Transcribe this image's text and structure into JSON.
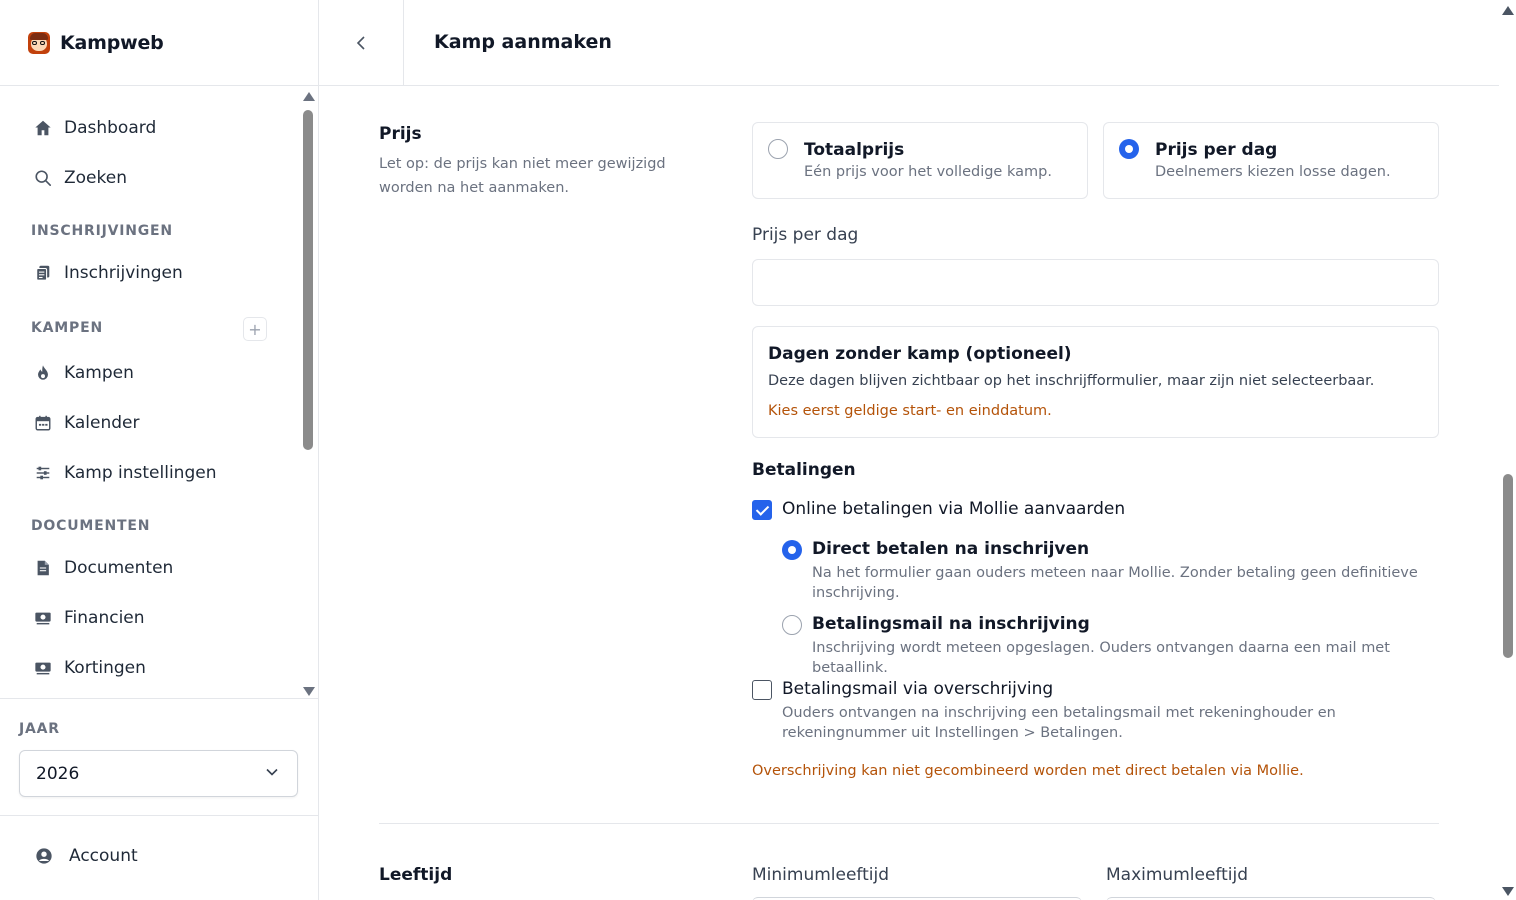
{
  "app": {
    "name": "Kampweb"
  },
  "header": {
    "title": "Kamp aanmaken",
    "back_icon": "chevron-left-icon"
  },
  "sidebar": {
    "items": [
      {
        "label": "Dashboard",
        "icon": "home-icon"
      },
      {
        "label": "Zoeken",
        "icon": "search-icon"
      }
    ],
    "sections": [
      {
        "title": "INSCHRIJVINGEN",
        "items": [
          {
            "label": "Inschrijvingen",
            "icon": "clipboard-icon"
          }
        ]
      },
      {
        "title": "KAMPEN",
        "items": [
          {
            "label": "Kampen",
            "icon": "fire-icon"
          },
          {
            "label": "Kalender",
            "icon": "calendar-icon"
          },
          {
            "label": "Kamp instellingen",
            "icon": "sliders-icon"
          }
        ]
      },
      {
        "title": "DOCUMENTEN",
        "items": [
          {
            "label": "Documenten",
            "icon": "document-icon"
          },
          {
            "label": "Financien",
            "icon": "money-icon"
          },
          {
            "label": "Kortingen",
            "icon": "money-icon"
          }
        ]
      }
    ],
    "add_label": "+",
    "year": {
      "label": "JAAR",
      "value": "2026"
    },
    "account": {
      "label": "Account",
      "icon": "user-circle-icon"
    }
  },
  "form": {
    "price": {
      "title": "Prijs",
      "description": "Let op: de prijs kan niet meer gewijzigd worden na het aanmaken.",
      "options": [
        {
          "title": "Totaalprijs",
          "description": "Eén prijs voor het volledige kamp.",
          "selected": false
        },
        {
          "title": "Prijs per dag",
          "description": "Deelnemers kiezen losse dagen.",
          "selected": true
        }
      ],
      "per_day_label": "Prijs per dag",
      "per_day_value": "",
      "days_off": {
        "title": "Dagen zonder kamp (optioneel)",
        "description": "Deze dagen blijven zichtbaar op het inschrijfformulier, maar zijn niet selecteerbaar.",
        "warning": "Kies eerst geldige start- en einddatum."
      }
    },
    "payments": {
      "title": "Betalingen",
      "mollie": {
        "label": "Online betalingen via Mollie aanvaarden",
        "checked": true
      },
      "mollie_options": [
        {
          "title": "Direct betalen na inschrijven",
          "description": "Na het formulier gaan ouders meteen naar Mollie. Zonder betaling geen definitieve inschrijving.",
          "selected": true
        },
        {
          "title": "Betalingsmail na inschrijving",
          "description": "Inschrijving wordt meteen opgeslagen. Ouders ontvangen daarna een mail met betaallink.",
          "selected": false
        }
      ],
      "transfer": {
        "label": "Betalingsmail via overschrijving",
        "description": "Ouders ontvangen na inschrijving een betalingsmail met rekeninghouder en rekeningnummer uit Instellingen > Betalingen.",
        "checked": false
      },
      "warning": "Overschrijving kan niet gecombineerd worden met direct betalen via Mollie."
    },
    "age": {
      "title": "Leeftijd",
      "min_label": "Minimumleeftijd",
      "max_label": "Maximumleeftijd"
    }
  },
  "colors": {
    "accent": "#2563eb",
    "warning": "#b45309"
  }
}
